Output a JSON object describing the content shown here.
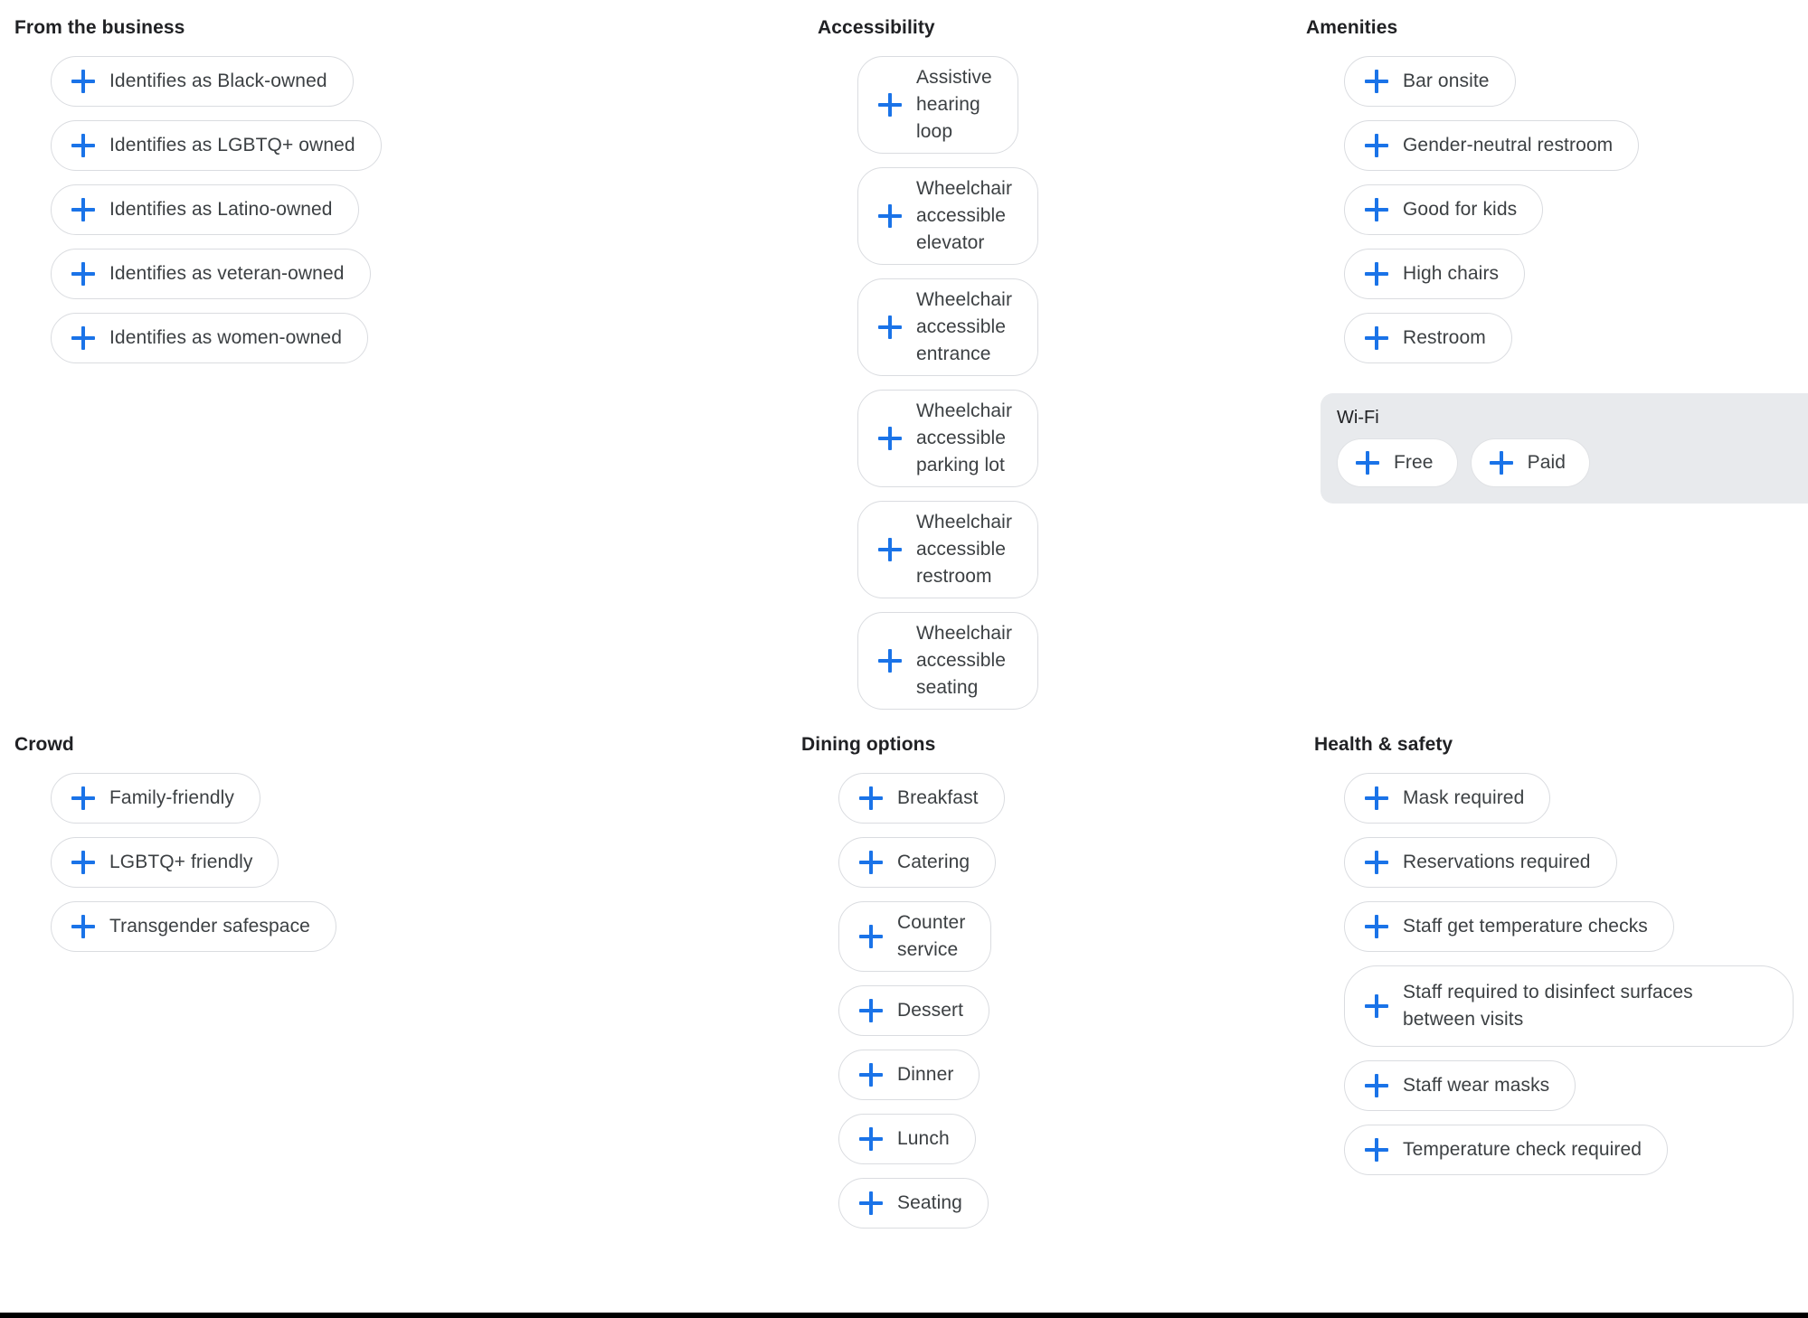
{
  "icons": {
    "add": "plus-icon"
  },
  "colors": {
    "accent_blue": "#1a73e8",
    "chip_border": "#dadce0",
    "chip_background": "#ffffff",
    "text_primary": "#202124",
    "text_secondary": "#3c4043",
    "subgroup_background": "#e8eaed"
  },
  "sections": [
    {
      "key": "from_the_business",
      "title": "From the business",
      "chips": [
        "Identifies as Black-owned",
        "Identifies as LGBTQ+ owned",
        "Identifies as Latino-owned",
        "Identifies as veteran-owned",
        "Identifies as women-owned"
      ]
    },
    {
      "key": "accessibility",
      "title": "Accessibility",
      "chips": [
        "Assistive hearing loop",
        "Wheelchair accessible elevator",
        "Wheelchair accessible entrance",
        "Wheelchair accessible parking lot",
        "Wheelchair accessible restroom",
        "Wheelchair accessible seating"
      ]
    },
    {
      "key": "amenities",
      "title": "Amenities",
      "chips": [
        "Bar onsite",
        "Gender-neutral restroom",
        "Good for kids",
        "High chairs",
        "Restroom"
      ],
      "subgroup": {
        "title": "Wi-Fi",
        "chips": [
          "Free",
          "Paid"
        ]
      }
    },
    {
      "key": "crowd",
      "title": "Crowd",
      "chips": [
        "Family-friendly",
        "LGBTQ+ friendly",
        "Transgender safespace"
      ]
    },
    {
      "key": "dining_options",
      "title": "Dining options",
      "chips": [
        "Breakfast",
        "Catering",
        "Counter service",
        "Dessert",
        "Dinner",
        "Lunch",
        "Seating"
      ]
    },
    {
      "key": "health_and_safety",
      "title": "Health & safety",
      "chips": [
        "Mask required",
        "Reservations required",
        "Staff get temperature checks",
        "Staff required to disinfect surfaces between visits",
        "Staff wear masks",
        "Temperature check required"
      ]
    }
  ]
}
